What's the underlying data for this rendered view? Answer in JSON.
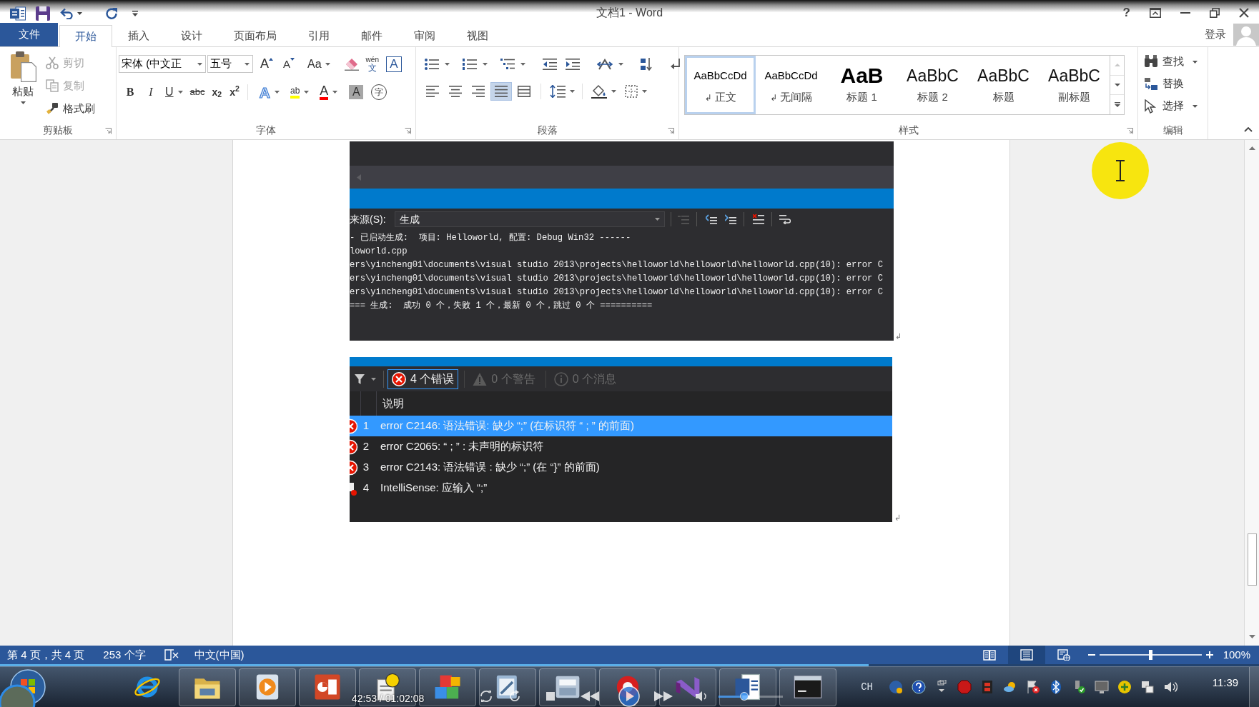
{
  "title_bar": {
    "title": "文档1 - Word",
    "help": "?"
  },
  "ribbon_tabs": [
    {
      "kind": "file",
      "label": "文件",
      "selected": false
    },
    {
      "kind": "tab",
      "label": "开始",
      "selected": true
    },
    {
      "kind": "tab",
      "label": "插入",
      "selected": false
    },
    {
      "kind": "tab",
      "label": "设计",
      "selected": false
    },
    {
      "kind": "tab",
      "label": "页面布局",
      "selected": false
    },
    {
      "kind": "tab",
      "label": "引用",
      "selected": false
    },
    {
      "kind": "tab",
      "label": "邮件",
      "selected": false
    },
    {
      "kind": "tab",
      "label": "审阅",
      "selected": false
    },
    {
      "kind": "tab",
      "label": "视图",
      "selected": false
    }
  ],
  "account": {
    "label": "登录"
  },
  "ribbon": {
    "clipboard": {
      "label": "剪贴板",
      "paste": "粘贴",
      "items": [
        {
          "kind": "cut",
          "label": "剪切",
          "disabled": true
        },
        {
          "kind": "copy",
          "label": "复制",
          "disabled": true
        },
        {
          "kind": "painter",
          "label": "格式刷",
          "disabled": false
        }
      ]
    },
    "font": {
      "label": "字体",
      "name": "宋体 (中文正",
      "size": "五号",
      "row1": [
        {
          "kind": "grow",
          "text": "A"
        },
        {
          "kind": "shrink",
          "text": "A"
        },
        {
          "kind": "case",
          "text": "Aa"
        },
        {
          "kind": "clear"
        },
        {
          "kind": "phonetic",
          "text": "wén",
          "sub": "文"
        },
        {
          "kind": "border",
          "text": "A"
        }
      ],
      "row2": [
        {
          "kind": "bold",
          "text": "B"
        },
        {
          "kind": "italic",
          "text": "I"
        },
        {
          "kind": "underline",
          "text": "U"
        },
        {
          "kind": "strike",
          "text": "abc"
        },
        {
          "kind": "subscript",
          "text": "x$_{2}$"
        },
        {
          "kind": "superscript",
          "text": "x$^{2}$"
        },
        {
          "kind": "effects",
          "text": "A"
        },
        {
          "kind": "highlight",
          "text": "ab"
        },
        {
          "kind": "color",
          "text": "A"
        },
        {
          "kind": "shading",
          "text": "A"
        },
        {
          "kind": "enclose",
          "text": "字"
        }
      ]
    },
    "paragraph": {
      "label": "段落",
      "alignments": [
        {
          "kind": "left",
          "selected": false
        },
        {
          "kind": "center",
          "selected": false
        },
        {
          "kind": "right",
          "selected": false
        },
        {
          "kind": "justify",
          "selected": true
        },
        {
          "kind": "distributed",
          "selected": false
        }
      ]
    },
    "styles": {
      "label": "样式",
      "items": [
        {
          "kind": "normal",
          "preview": "AaBbCcDd",
          "mark": "↲",
          "name": "正文",
          "selected": true
        },
        {
          "kind": "no_spacing",
          "preview": "AaBbCcDd",
          "mark": "↲",
          "name": "无间隔",
          "selected": false
        },
        {
          "kind": "heading1",
          "preview": "AaB",
          "name": "标题 1",
          "selected": false
        },
        {
          "kind": "heading2",
          "preview": "AaBbC",
          "name": "标题 2",
          "selected": false
        },
        {
          "kind": "title",
          "preview": "AaBbC",
          "name": "标题",
          "selected": false
        },
        {
          "kind": "subtitle",
          "preview": "AaBbC",
          "name": "副标题",
          "selected": false
        }
      ]
    },
    "editing": {
      "label": "编辑",
      "items": [
        {
          "kind": "find",
          "label": "查找",
          "dropdown": true
        },
        {
          "kind": "replace",
          "label": "替换",
          "dropdown": false
        },
        {
          "kind": "select",
          "label": "选择",
          "dropdown": true
        }
      ]
    }
  },
  "document": {
    "output_window": {
      "source_label": "来源(S):",
      "source_value": "生成",
      "lines": [
        "- 已启动生成:  项目: Helloworld, 配置: Debug Win32 ------",
        "loworld.cpp",
        "ers\\yincheng01\\documents\\visual studio 2013\\projects\\helloworld\\helloworld\\helloworld.cpp(10): error C",
        "ers\\yincheng01\\documents\\visual studio 2013\\projects\\helloworld\\helloworld\\helloworld.cpp(10): error C",
        "ers\\yincheng01\\documents\\visual studio 2013\\projects\\helloworld\\helloworld\\helloworld.cpp(10): error C",
        "=== 生成:  成功 0 个，失败 1 个，最新 0 个，跳过 0 个 =========="
      ],
      "paragraph_mark": "↲"
    },
    "error_list": {
      "filters": [
        {
          "kind": "error",
          "label": "4 个错误",
          "selected": true,
          "disabled": false
        },
        {
          "kind": "warning",
          "label": "0 个警告",
          "selected": false,
          "disabled": true
        },
        {
          "kind": "info",
          "label": "0 个消息",
          "selected": false,
          "disabled": true
        }
      ],
      "column": "说明",
      "rows": [
        {
          "kind": "error",
          "number": "1",
          "description": "error C2146: 语法错误: 缺少 “;” (在标识符 “ ; ” 的前面)",
          "selected": true
        },
        {
          "kind": "error",
          "number": "2",
          "description": "error C2065:  “ ; ” : 未声明的标识符",
          "selected": false
        },
        {
          "kind": "error",
          "number": "3",
          "description": "error C2143: 语法错误 : 缺少 “;” (在 “}” 的前面)",
          "selected": false
        },
        {
          "kind": "intellisense",
          "number": "4",
          "description": "IntelliSense:  应输入 “;”",
          "selected": false
        }
      ],
      "paragraph_mark": "↲"
    }
  },
  "status_bar": {
    "page": "第 4 页，共 4 页",
    "words": "253 个字",
    "language": "中文(中国)",
    "views": [
      {
        "kind": "read",
        "selected": false
      },
      {
        "kind": "print",
        "selected": true
      },
      {
        "kind": "web",
        "selected": false
      }
    ],
    "zoom": {
      "level": 0.5,
      "label": "100%"
    }
  },
  "video_player": {
    "time": "42:53 / 01:02:08",
    "level": 0.69,
    "volume": {
      "level": 0.33
    }
  },
  "taskbar": {
    "apps": [
      {
        "kind": "ie",
        "running": false
      },
      {
        "kind": "explorer",
        "running": true
      },
      {
        "kind": "media",
        "running": true
      },
      {
        "kind": "powerpoint",
        "running": true
      },
      {
        "kind": "help",
        "running": true
      },
      {
        "kind": "mfc",
        "running": true
      },
      {
        "kind": "notepad",
        "running": true
      },
      {
        "kind": "calculator",
        "running": true
      },
      {
        "kind": "recorder",
        "running": true
      },
      {
        "kind": "visual_studio",
        "running": true
      },
      {
        "kind": "word",
        "running": true
      },
      {
        "kind": "console",
        "running": true
      }
    ],
    "input_language": "CH",
    "clock": "11:39"
  }
}
